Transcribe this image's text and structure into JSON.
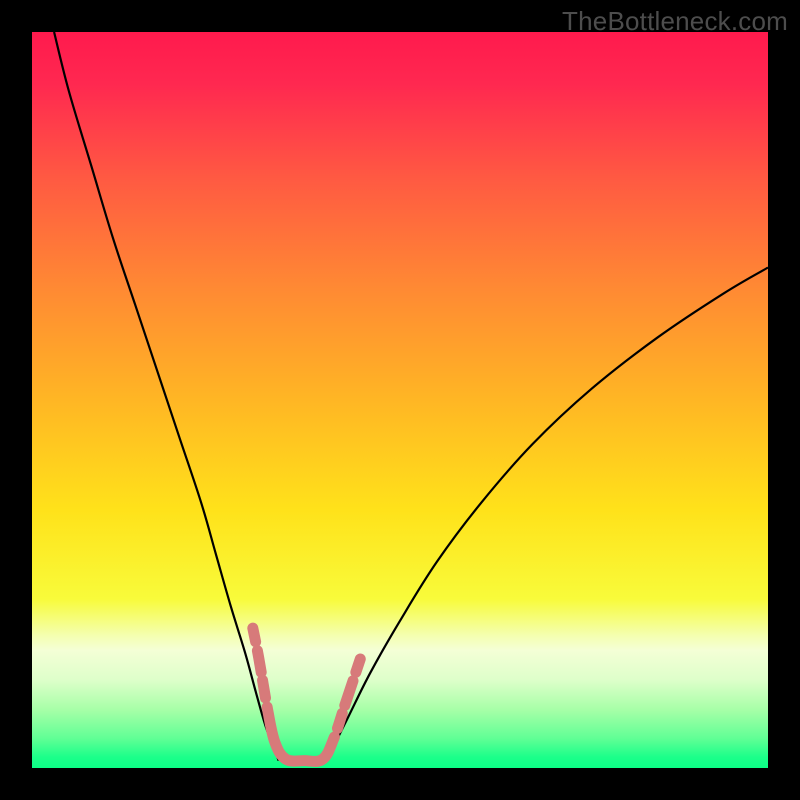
{
  "watermark": "TheBottleneck.com",
  "chart_data": {
    "type": "line",
    "title": "",
    "xlabel": "",
    "ylabel": "",
    "xlim": [
      0,
      100
    ],
    "ylim": [
      0,
      100
    ],
    "grid": false,
    "background_gradient_stops": [
      {
        "offset": 0,
        "color": "#ff1a4d"
      },
      {
        "offset": 0.07,
        "color": "#ff2850"
      },
      {
        "offset": 0.2,
        "color": "#ff5a42"
      },
      {
        "offset": 0.35,
        "color": "#ff8a33"
      },
      {
        "offset": 0.5,
        "color": "#ffb624"
      },
      {
        "offset": 0.65,
        "color": "#ffe21a"
      },
      {
        "offset": 0.77,
        "color": "#f8fb3a"
      },
      {
        "offset": 0.82,
        "color": "#f4ffb0"
      },
      {
        "offset": 0.84,
        "color": "#f4ffd6"
      },
      {
        "offset": 0.88,
        "color": "#deffca"
      },
      {
        "offset": 0.92,
        "color": "#a8ffa8"
      },
      {
        "offset": 0.96,
        "color": "#60ff95"
      },
      {
        "offset": 0.985,
        "color": "#1cff8a"
      },
      {
        "offset": 1.0,
        "color": "#0cff86"
      }
    ],
    "series": [
      {
        "name": "left-curve",
        "color": "#000000",
        "width": 2.2,
        "x": [
          3,
          5,
          8,
          11,
          14,
          17,
          20,
          23,
          25,
          27,
          29,
          30.5,
          31.8,
          33,
          33.5
        ],
        "y": [
          100,
          92,
          82,
          72,
          63,
          54,
          45,
          36,
          29,
          22,
          15.5,
          10,
          5.5,
          2.5,
          1.0
        ]
      },
      {
        "name": "right-curve",
        "color": "#000000",
        "width": 2.2,
        "x": [
          40,
          41,
          43,
          46,
          50,
          55,
          61,
          68,
          76,
          85,
          94,
          100
        ],
        "y": [
          1.0,
          3,
          7,
          13,
          20,
          28,
          36,
          44,
          51.5,
          58.5,
          64.5,
          68
        ]
      }
    ],
    "overlay_segments": {
      "name": "bottom-dash-path",
      "color": "#d77a7a",
      "width": 11,
      "linecap": "round",
      "points": [
        {
          "x": 30.0,
          "y": 19.0
        },
        {
          "x": 30.8,
          "y": 15.0
        },
        {
          "x": 32.0,
          "y": 8.0
        },
        {
          "x": 33.0,
          "y": 3.5
        },
        {
          "x": 34.5,
          "y": 1.2
        },
        {
          "x": 37.0,
          "y": 1.0
        },
        {
          "x": 39.5,
          "y": 1.2
        },
        {
          "x": 41.0,
          "y": 4.0
        },
        {
          "x": 42.5,
          "y": 8.5
        },
        {
          "x": 44.0,
          "y": 13.0
        },
        {
          "x": 45.0,
          "y": 16.0
        }
      ]
    }
  }
}
